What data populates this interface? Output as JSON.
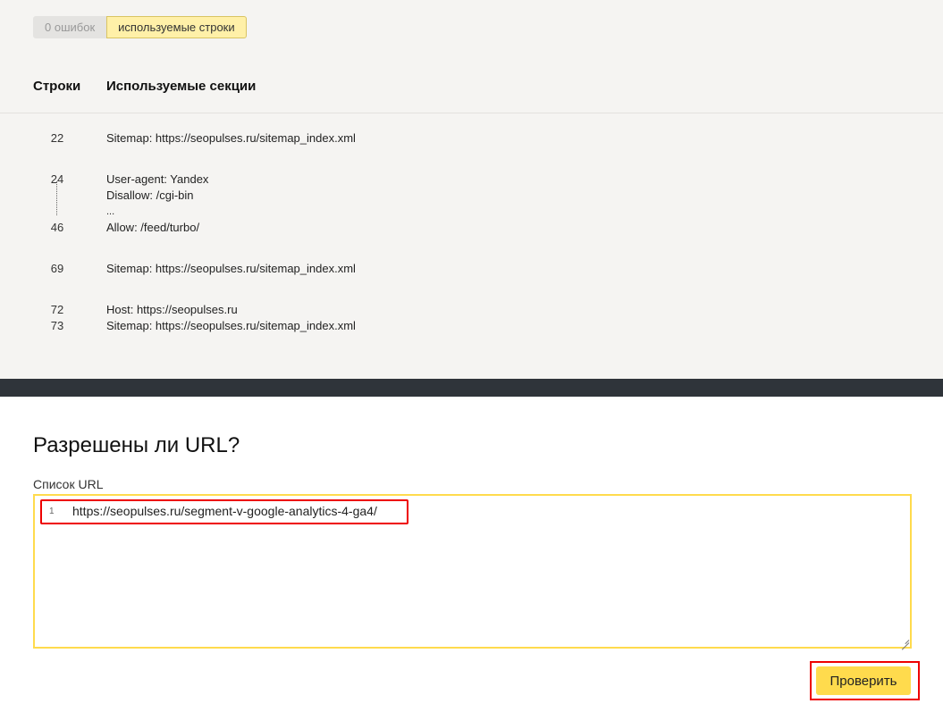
{
  "filters": {
    "errors_label": "0 ошибок",
    "used_lines_label": "используемые строки"
  },
  "table": {
    "col_lines": "Строки",
    "col_sections": "Используемые секции",
    "groups": [
      {
        "lines": [
          {
            "num": "22",
            "text": "Sitemap: https://seopulses.ru/sitemap_index.xml"
          }
        ]
      },
      {
        "lines": [
          {
            "num": "24",
            "text": "User-agent: Yandex"
          },
          {
            "num": "",
            "text": "Disallow: /cgi-bin"
          },
          {
            "num": "",
            "text": "..."
          },
          {
            "num": "46",
            "text": "Allow: /feed/turbo/"
          }
        ]
      },
      {
        "lines": [
          {
            "num": "69",
            "text": "Sitemap: https://seopulses.ru/sitemap_index.xml"
          }
        ]
      },
      {
        "lines": [
          {
            "num": "72",
            "text": "Host: https://seopulses.ru"
          },
          {
            "num": "73",
            "text": "Sitemap: https://seopulses.ru/sitemap_index.xml"
          }
        ]
      }
    ]
  },
  "url_check": {
    "title": "Разрешены ли URL?",
    "list_label": "Список URL",
    "lines": [
      {
        "num": "1",
        "text": "https://seopulses.ru/segment-v-google-analytics-4-ga4/"
      }
    ],
    "check_button": "Проверить"
  },
  "colors": {
    "accent": "#ffdb4d",
    "highlight": "#e00000",
    "dark_bar": "#2f343a",
    "panel_bg": "#f5f4f2"
  }
}
